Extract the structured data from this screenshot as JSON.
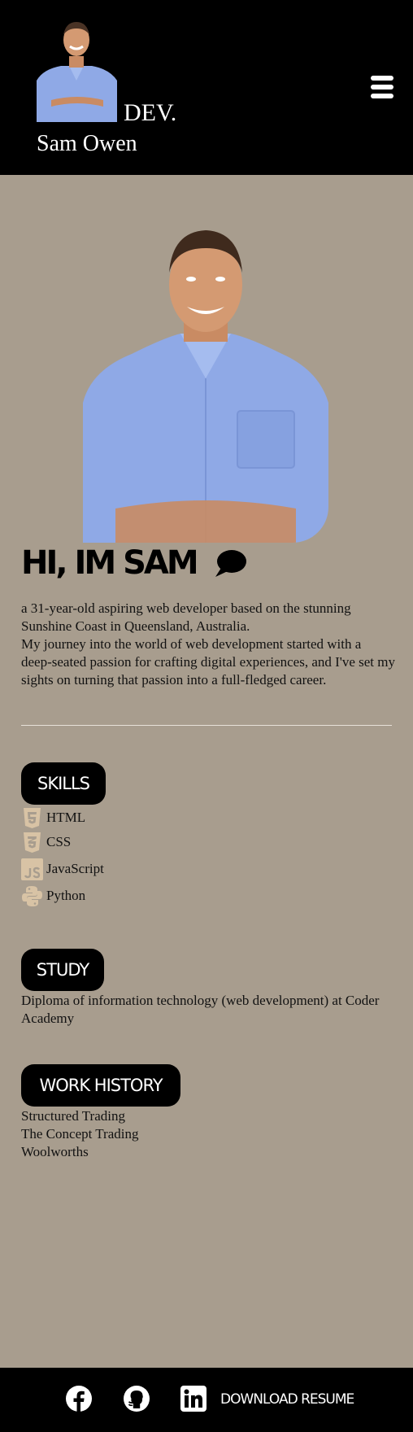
{
  "header": {
    "dev_label": "DEV.",
    "name": "Sam Owen"
  },
  "hero": {
    "title": "HI, IM SAM",
    "intro_line1": "a 31-year-old aspiring web developer based on the stunning Sunshine Coast in Queensland, Australia.",
    "intro_line2": "My journey into the world of web development started with a deep-seated passion for crafting digital experiences, and I've set my sights on turning that passion into a full-fledged career."
  },
  "skills": {
    "heading": "SKILLS",
    "items": [
      {
        "label": "HTML",
        "icon": "html5-icon"
      },
      {
        "label": "CSS",
        "icon": "css3-icon"
      },
      {
        "label": "JavaScript",
        "icon": "js-icon"
      },
      {
        "label": "Python",
        "icon": "python-icon"
      }
    ]
  },
  "study": {
    "heading": "STUDY",
    "text": "Diploma of information technology (web development) at Coder Academy"
  },
  "work": {
    "heading": "WORK HISTORY",
    "items": [
      "Structured Trading",
      "The Concept Trading",
      "Woolworths"
    ]
  },
  "footer": {
    "resume_label": "DOWNLOAD RESUME"
  },
  "colors": {
    "header_bg": "#000000",
    "main_bg": "#a89d8e",
    "icon_tan": "#d8c3a5",
    "shirt": "#8fa9e6"
  }
}
